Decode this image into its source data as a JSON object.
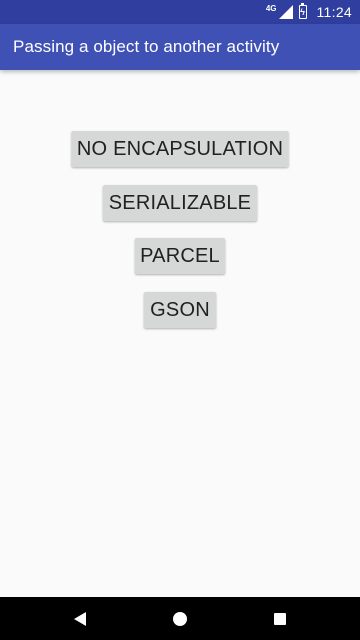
{
  "status_bar": {
    "network_label": "4G",
    "time": "11:24",
    "icons": [
      "signal-icon",
      "battery-charging-icon"
    ]
  },
  "app_bar": {
    "title": "Passing a object to another activity"
  },
  "buttons": [
    {
      "label": "NO ENCAPSULATION"
    },
    {
      "label": "SERIALIZABLE"
    },
    {
      "label": "PARCEL"
    },
    {
      "label": "GSON"
    }
  ],
  "nav_bar": {
    "icons": [
      "back-icon",
      "home-icon",
      "recents-icon"
    ]
  },
  "colors": {
    "status_bar": "#303f9f",
    "app_bar": "#3f51b5",
    "background": "#fafafa",
    "button": "#d6d7d7",
    "button_text": "#212121",
    "nav_bar": "#000000"
  }
}
